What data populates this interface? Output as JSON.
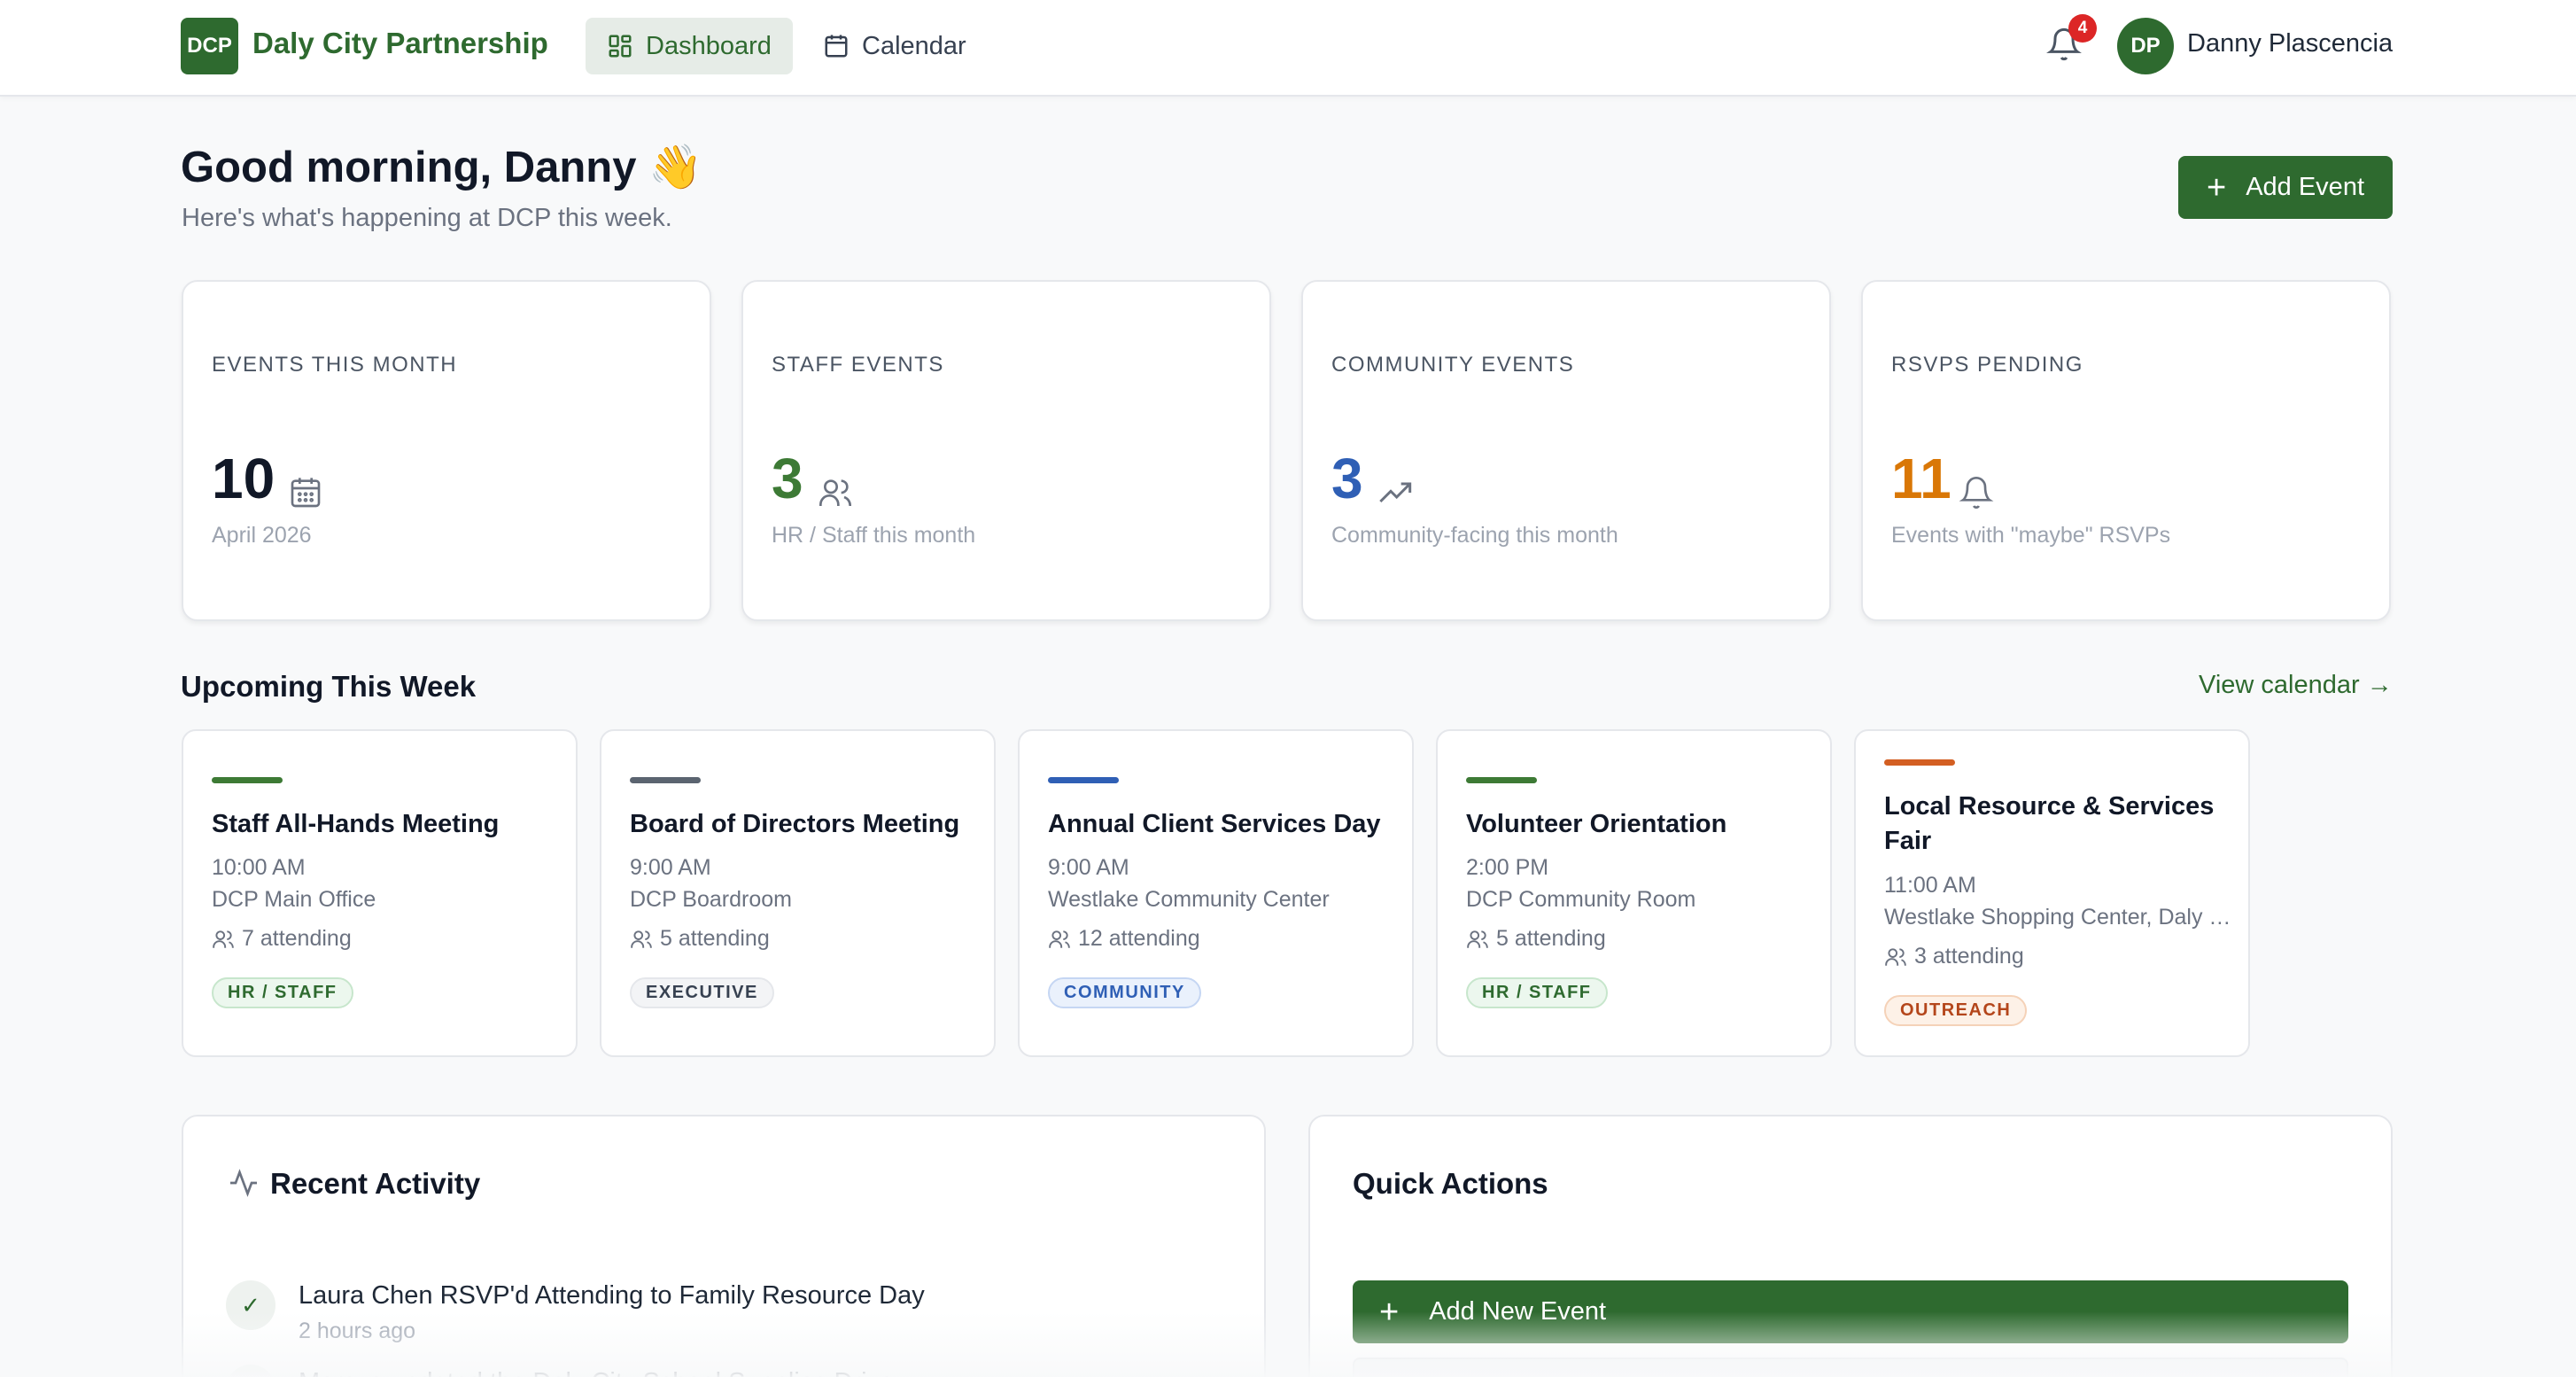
{
  "nav": {
    "logo_text": "DCP",
    "brand": "Daly City Partnership",
    "tabs": [
      {
        "label": "Dashboard",
        "icon": "dashboard-icon",
        "active": true
      },
      {
        "label": "Calendar",
        "icon": "calendar-icon",
        "active": false
      }
    ],
    "notification_count": "4",
    "user_initials": "DP",
    "user_name": "Danny Plascencia"
  },
  "header": {
    "greeting": "Good morning, Danny 👋",
    "subtitle": "Here's what's happening at DCP this week.",
    "add_event_label": "Add Event"
  },
  "stats": [
    {
      "label": "EVENTS THIS MONTH",
      "value": "10",
      "sub": "April 2026",
      "icon": "calendar-icon",
      "color": "#111827"
    },
    {
      "label": "STAFF EVENTS",
      "value": "3",
      "sub": "HR / Staff this month",
      "icon": "users-icon",
      "color": "#3d7a35"
    },
    {
      "label": "COMMUNITY EVENTS",
      "value": "3",
      "sub": "Community-facing this month",
      "icon": "trending-up-icon",
      "color": "#2f5fb5"
    },
    {
      "label": "RSVPS PENDING",
      "value": "11",
      "sub": "Events with \"maybe\" RSVPs",
      "icon": "bell-icon",
      "color": "#d97706"
    }
  ],
  "upcoming": {
    "title": "Upcoming This Week",
    "view_calendar": "View calendar →",
    "events": [
      {
        "title": "Staff All-Hands Meeting",
        "time": "10:00 AM",
        "location": "DCP Main Office",
        "attending": "7 attending",
        "tag": "HR / STAFF",
        "bar_color": "#3d7a35"
      },
      {
        "title": "Board of Directors Meeting",
        "time": "9:00 AM",
        "location": "DCP Boardroom",
        "attending": "5 attending",
        "tag": "EXECUTIVE",
        "bar_color": "#5b6470"
      },
      {
        "title": "Annual Client Services Day",
        "time": "9:00 AM",
        "location": "Westlake Community Center",
        "attending": "12 attending",
        "tag": "COMMUNITY",
        "bar_color": "#2f5fb5"
      },
      {
        "title": "Volunteer Orientation",
        "time": "2:00 PM",
        "location": "DCP Community Room",
        "attending": "5 attending",
        "tag": "HR / STAFF",
        "bar_color": "#3d7a35"
      },
      {
        "title": "Local Resource & Services Fair",
        "time": "11:00 AM",
        "location": "Westlake Shopping Center, Daly City",
        "attending": "3 attending",
        "tag": "OUTREACH",
        "bar_color": "#d35f22"
      }
    ]
  },
  "activity": {
    "title": "Recent Activity",
    "items": [
      {
        "text": "Laura Chen RSVP'd Attending to Family Resource Day",
        "time": "2 hours ago"
      },
      {
        "text": "Marcus updated the Daly City School Supplies Drive",
        "time": ""
      }
    ]
  },
  "quick_actions": {
    "title": "Quick Actions",
    "add_new_event": "Add New Event"
  }
}
